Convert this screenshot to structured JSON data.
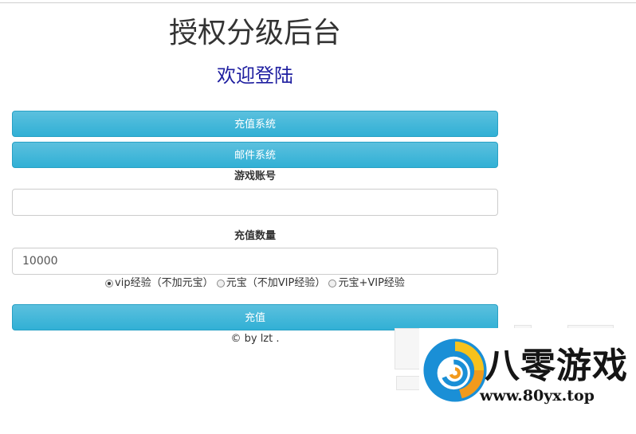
{
  "page": {
    "title": "授权分级后台",
    "subtitle": "欢迎登陆"
  },
  "nav": {
    "recharge_system": "充值系统",
    "mail_system": "邮件系统"
  },
  "form": {
    "account_label": "游戏账号",
    "account_value": "",
    "amount_label": "充值数量",
    "amount_value": "10000",
    "options": [
      {
        "label": "vip经验（不加元宝）",
        "checked": true
      },
      {
        "label": "元宝（不加VIP经验）",
        "checked": false
      },
      {
        "label": "元宝+VIP经验",
        "checked": false
      }
    ],
    "submit_label": "充值"
  },
  "footer": {
    "text": "© by lzt ."
  },
  "watermark": {
    "brand": "八零游戏",
    "url": "www.80yx.top"
  },
  "colors": {
    "button_bg": "#5bc0de",
    "title_text": "#333333",
    "subtitle_text": "#1f1fa0"
  }
}
